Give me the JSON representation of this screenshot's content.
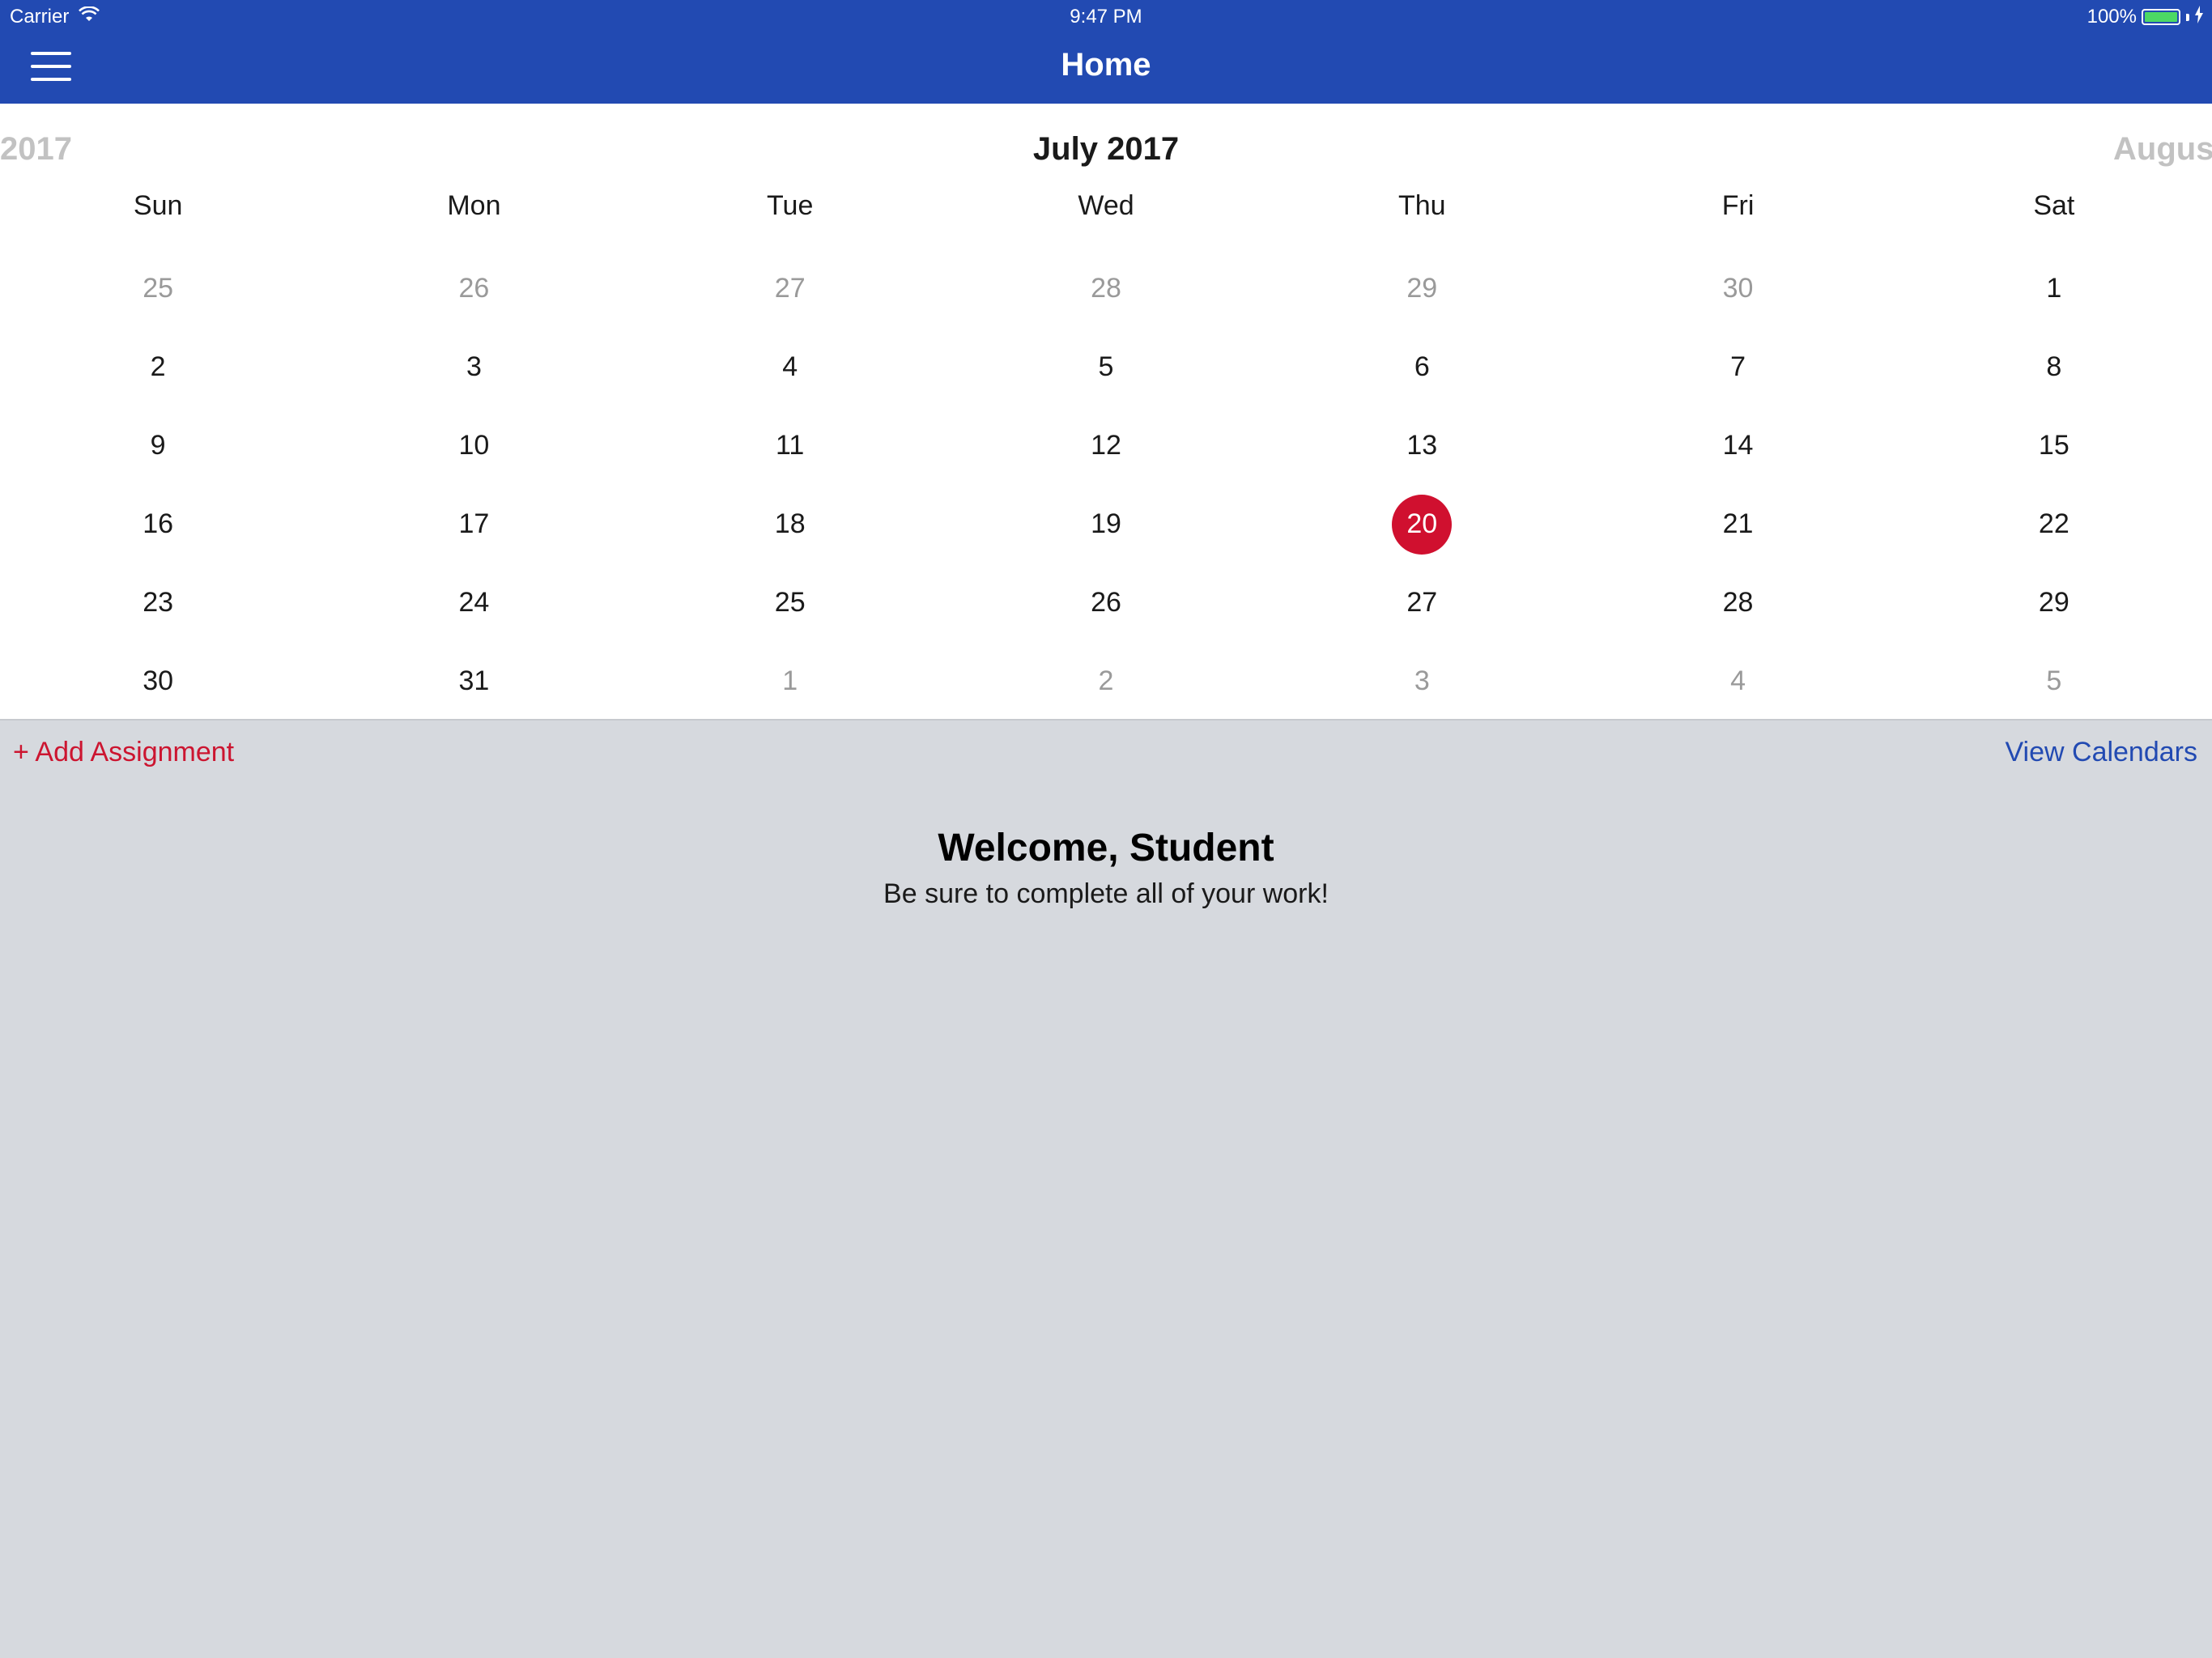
{
  "status_bar": {
    "carrier": "Carrier",
    "time": "9:47 PM",
    "battery_text": "100%",
    "icons": [
      "wifi-icon",
      "battery-icon",
      "charging-icon"
    ]
  },
  "nav": {
    "title": "Home",
    "menu_icon": "hamburger-menu-icon"
  },
  "calendar": {
    "prev_label": "2017",
    "current_label": "July 2017",
    "next_label": "August",
    "weekdays": [
      "Sun",
      "Mon",
      "Tue",
      "Wed",
      "Thu",
      "Fri",
      "Sat"
    ],
    "selected_day": "20",
    "weeks": [
      [
        {
          "day": "25",
          "in_month": false
        },
        {
          "day": "26",
          "in_month": false
        },
        {
          "day": "27",
          "in_month": false
        },
        {
          "day": "28",
          "in_month": false
        },
        {
          "day": "29",
          "in_month": false
        },
        {
          "day": "30",
          "in_month": false
        },
        {
          "day": "1",
          "in_month": true
        }
      ],
      [
        {
          "day": "2",
          "in_month": true
        },
        {
          "day": "3",
          "in_month": true
        },
        {
          "day": "4",
          "in_month": true
        },
        {
          "day": "5",
          "in_month": true
        },
        {
          "day": "6",
          "in_month": true
        },
        {
          "day": "7",
          "in_month": true
        },
        {
          "day": "8",
          "in_month": true
        }
      ],
      [
        {
          "day": "9",
          "in_month": true
        },
        {
          "day": "10",
          "in_month": true
        },
        {
          "day": "11",
          "in_month": true
        },
        {
          "day": "12",
          "in_month": true
        },
        {
          "day": "13",
          "in_month": true
        },
        {
          "day": "14",
          "in_month": true
        },
        {
          "day": "15",
          "in_month": true
        }
      ],
      [
        {
          "day": "16",
          "in_month": true
        },
        {
          "day": "17",
          "in_month": true
        },
        {
          "day": "18",
          "in_month": true
        },
        {
          "day": "19",
          "in_month": true
        },
        {
          "day": "20",
          "in_month": true,
          "selected": true
        },
        {
          "day": "21",
          "in_month": true
        },
        {
          "day": "22",
          "in_month": true
        }
      ],
      [
        {
          "day": "23",
          "in_month": true
        },
        {
          "day": "24",
          "in_month": true
        },
        {
          "day": "25",
          "in_month": true
        },
        {
          "day": "26",
          "in_month": true
        },
        {
          "day": "27",
          "in_month": true
        },
        {
          "day": "28",
          "in_month": true
        },
        {
          "day": "29",
          "in_month": true
        }
      ],
      [
        {
          "day": "30",
          "in_month": true
        },
        {
          "day": "31",
          "in_month": true
        },
        {
          "day": "1",
          "in_month": false
        },
        {
          "day": "2",
          "in_month": false
        },
        {
          "day": "3",
          "in_month": false
        },
        {
          "day": "4",
          "in_month": false
        },
        {
          "day": "5",
          "in_month": false
        }
      ]
    ]
  },
  "actions": {
    "add_assignment": "+ Add Assignment",
    "view_calendars": "View Calendars"
  },
  "welcome": {
    "title": "Welcome, Student",
    "subtitle": "Be sure to complete all of your work!"
  },
  "colors": {
    "nav_blue": "#224ab2",
    "accent_red": "#d0102f",
    "panel_gray": "#d6d9de",
    "battery_green": "#4cd964"
  }
}
